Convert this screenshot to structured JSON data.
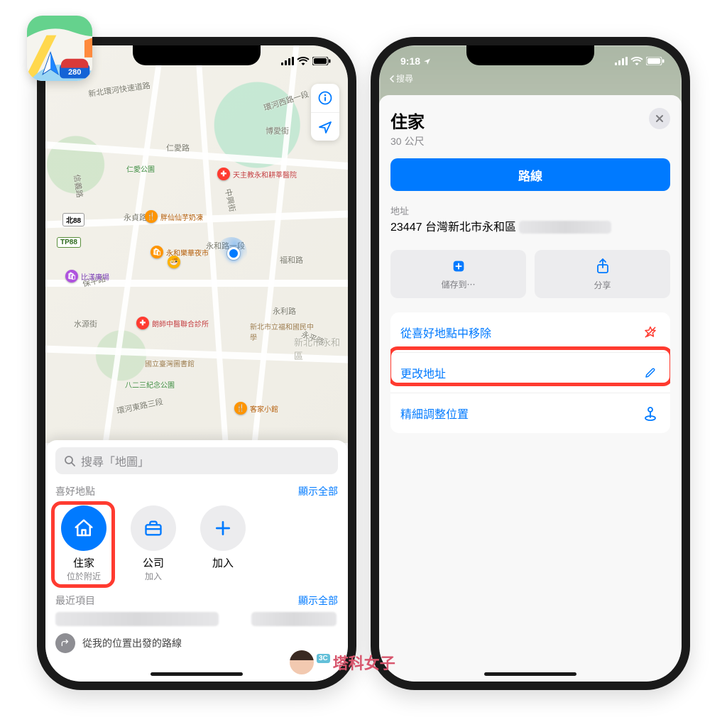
{
  "watermark": "塔科女子",
  "left": {
    "status": {
      "signal": "􀙇",
      "wifi": "􀙈",
      "battery_full": true
    },
    "map": {
      "road_labels": [
        "新北環河快速道路",
        "仁愛路",
        "博愛街",
        "永貞路",
        "信義路",
        "中興街",
        "福和路",
        "水源街",
        "永和路一段",
        "保平路",
        "永利路",
        "永平路",
        "環河東路三段",
        "環河西路一段"
      ],
      "pois": [
        {
          "name": "天主教永和耕莘醫院",
          "kind": "hospital"
        },
        {
          "name": "胖仙仙芋奶凍",
          "kind": "food"
        },
        {
          "name": "永和樂華夜市",
          "kind": "market"
        },
        {
          "name": "朗師中醫聯合診所",
          "kind": "clinic"
        },
        {
          "name": "新北市立福和國民中學",
          "kind": "school"
        },
        {
          "name": "國立臺灣圖書館",
          "kind": "library"
        },
        {
          "name": "八二三紀念公園",
          "kind": "park"
        },
        {
          "name": "仁愛公園",
          "kind": "park"
        },
        {
          "name": "比漾廣場",
          "kind": "mall"
        },
        {
          "name": "客家小館",
          "kind": "food"
        }
      ],
      "route_badges": [
        "北88",
        "TP88"
      ],
      "region": "新北市永和區"
    },
    "map_buttons": {
      "info": "i",
      "locate": "➤"
    },
    "search_placeholder": "搜尋「地圖」",
    "favorites": {
      "header": "喜好地點",
      "show_all": "顯示全部",
      "items": [
        {
          "title": "住家",
          "subtitle": "位於附近",
          "icon": "home"
        },
        {
          "title": "公司",
          "subtitle": "加入",
          "icon": "briefcase"
        },
        {
          "title": "加入",
          "subtitle": "",
          "icon": "plus"
        }
      ]
    },
    "recents": {
      "header": "最近項目",
      "show_all": "顯示全部",
      "route_line": "從我的位置出發的路線"
    }
  },
  "right": {
    "status": {
      "time": "9:18",
      "crumb": "搜尋"
    },
    "detail": {
      "title": "住家",
      "distance": "30 公尺",
      "primary": "路線",
      "addr_label": "地址",
      "addr": "23447 台灣新北市永和區",
      "save_to": "儲存到⋯",
      "share": "分享",
      "actions": {
        "remove_fav": "從喜好地點中移除",
        "change_addr": "更改地址",
        "refine_loc": "精細調整位置"
      }
    }
  }
}
